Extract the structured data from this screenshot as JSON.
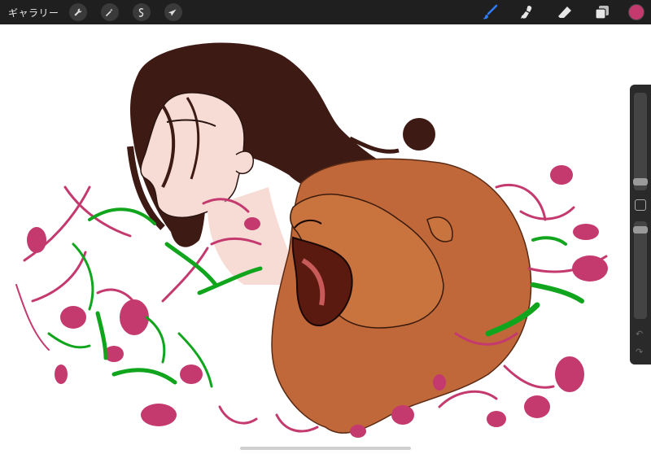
{
  "toolbar": {
    "gallery_label": "ギャラリー",
    "left_icons": [
      "wrench-icon",
      "magic-wand-icon",
      "selection-icon",
      "transform-arrow-icon"
    ],
    "right_icons": [
      "brush-icon",
      "smudge-icon",
      "eraser-icon",
      "layers-icon"
    ],
    "active_tool": "brush",
    "current_color": "#c43a6f"
  },
  "sidebar": {
    "brush_size": 0.05,
    "opacity": 0.95
  },
  "colors": {
    "toolbar_bg": "#1f1f1f",
    "accent_blue": "#2f7dff",
    "hair": "#3d1a14",
    "lion": "#c0683a",
    "magenta": "#c43a6f",
    "green": "#10a51c"
  }
}
